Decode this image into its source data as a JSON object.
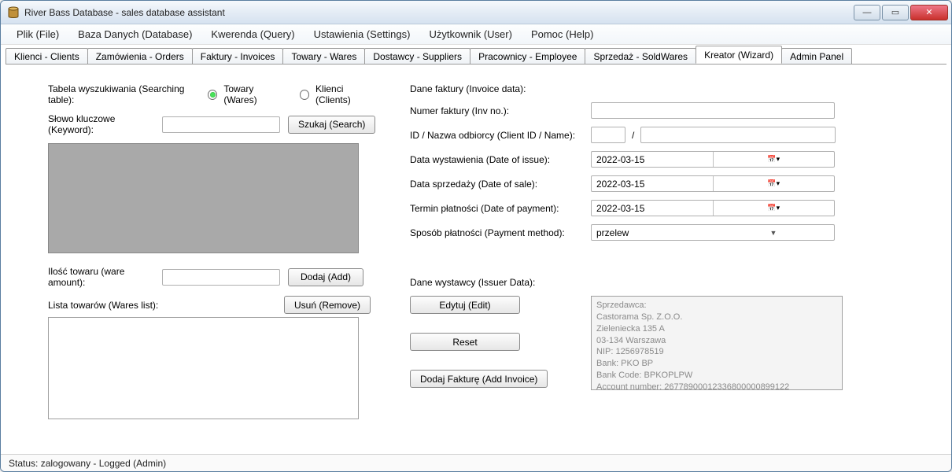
{
  "window": {
    "title": "River Bass Database - sales database assistant"
  },
  "menus": [
    "Plik (File)",
    "Baza Danych (Database)",
    "Kwerenda (Query)",
    "Ustawienia (Settings)",
    "Użytkownik (User)",
    "Pomoc (Help)"
  ],
  "tabs": {
    "items": [
      "Klienci - Clients",
      "Zamówienia - Orders",
      "Faktury - Invoices",
      "Towary - Wares",
      "Dostawcy - Suppliers",
      "Pracownicy - Employee",
      "Sprzedaż - SoldWares",
      "Kreator (Wizard)",
      "Admin Panel"
    ],
    "active_index": 7
  },
  "left": {
    "search_table_label": "Tabela wyszukiwania (Searching table):",
    "radio_wares": "Towary (Wares)",
    "radio_clients": "Klienci (Clients)",
    "radio_selected": "wares",
    "keyword_label": "Słowo kluczowe (Keyword):",
    "keyword_value": "",
    "search_btn": "Szukaj (Search)",
    "amount_label": "Ilość towaru (ware amount):",
    "amount_value": "",
    "add_btn": "Dodaj (Add)",
    "wares_list_label": "Lista towarów (Wares list):",
    "remove_btn": "Usuń (Remove)"
  },
  "right": {
    "invoice_data_label": "Dane faktury (Invoice data):",
    "inv_no_label": "Numer faktury (Inv no.):",
    "inv_no_value": "",
    "client_label": "ID / Nazwa odbiorcy (Client ID / Name):",
    "client_id": "",
    "client_name": "",
    "issue_date_label": "Data wystawienia (Date of issue):",
    "issue_date": "2022-03-15",
    "sale_date_label": "Data sprzedaży (Date of sale):",
    "sale_date": "2022-03-15",
    "payment_date_label": "Termin płatności (Date of payment):",
    "payment_date": "2022-03-15",
    "payment_method_label": "Sposób płatności (Payment method):",
    "payment_method": "przelew",
    "issuer_label": "Dane wystawcy (Issuer Data):",
    "edit_btn": "Edytuj (Edit)",
    "reset_btn": "Reset",
    "add_invoice_btn": "Dodaj Fakturę (Add Invoice)",
    "issuer_text": "Sprzedawca:\nCastorama Sp. Z.O.O.\nZieleniecka 135 A\n03-134 Warszawa\nNIP: 1256978519\nBank: PKO BP\nBank Code: BPKOPLPW\nAccount number: 26778900012336800000899122"
  },
  "statusbar": "Status: zalogowany - Logged (Admin)"
}
